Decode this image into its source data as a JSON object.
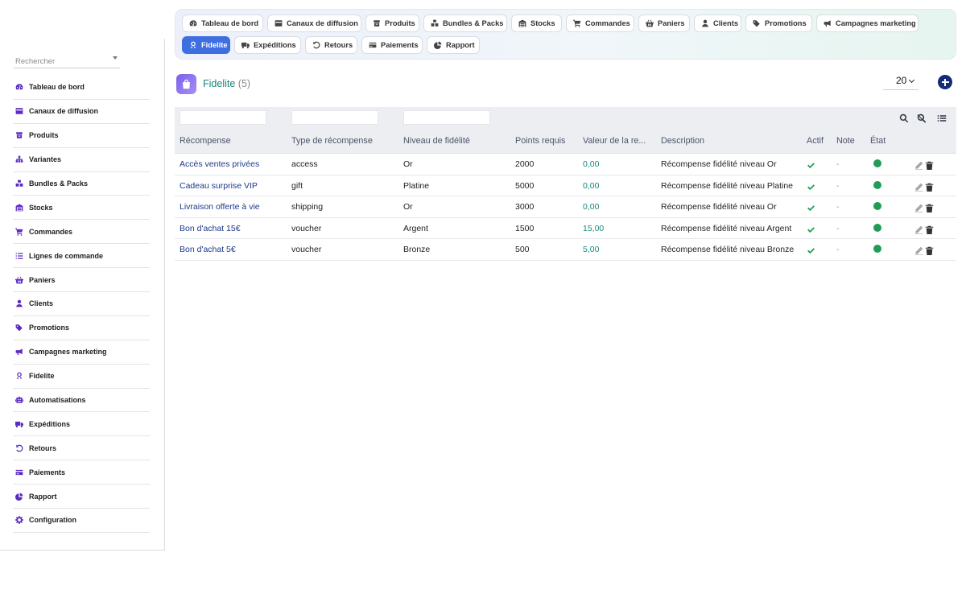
{
  "sidebar": {
    "search_placeholder": "Rechercher",
    "items": [
      {
        "label": "Tableau de bord",
        "icon": "gauge-icon"
      },
      {
        "label": "Canaux de diffusion",
        "icon": "channel-icon"
      },
      {
        "label": "Produits",
        "icon": "box-icon"
      },
      {
        "label": "Variantes",
        "icon": "sitemap-icon"
      },
      {
        "label": "Bundles & Packs",
        "icon": "boxes-icon"
      },
      {
        "label": "Stocks",
        "icon": "warehouse-icon"
      },
      {
        "label": "Commandes",
        "icon": "cart-icon"
      },
      {
        "label": "Lignes de commande",
        "icon": "list-icon"
      },
      {
        "label": "Paniers",
        "icon": "basket-icon"
      },
      {
        "label": "Clients",
        "icon": "user-icon"
      },
      {
        "label": "Promotions",
        "icon": "tags-icon"
      },
      {
        "label": "Campagnes marketing",
        "icon": "megaphone-icon"
      },
      {
        "label": "Fidelite",
        "icon": "award-icon"
      },
      {
        "label": "Automatisations",
        "icon": "robot-icon"
      },
      {
        "label": "Expéditions",
        "icon": "truck-icon"
      },
      {
        "label": "Retours",
        "icon": "undo-icon"
      },
      {
        "label": "Paiements",
        "icon": "credit-card-icon"
      },
      {
        "label": "Rapport",
        "icon": "pie-chart-icon"
      },
      {
        "label": "Configuration",
        "icon": "gear-icon"
      }
    ]
  },
  "tabs": [
    {
      "label": "Tableau de bord",
      "icon": "gauge-icon",
      "active": false
    },
    {
      "label": "Canaux de diffusion",
      "icon": "channel-icon",
      "active": false
    },
    {
      "label": "Produits",
      "icon": "box-icon",
      "active": false
    },
    {
      "label": "Bundles & Packs",
      "icon": "boxes-icon",
      "active": false
    },
    {
      "label": "Stocks",
      "icon": "warehouse-icon",
      "active": false
    },
    {
      "label": "Commandes",
      "icon": "cart-icon",
      "active": false
    },
    {
      "label": "Paniers",
      "icon": "basket-icon",
      "active": false
    },
    {
      "label": "Clients",
      "icon": "user-icon",
      "active": false
    },
    {
      "label": "Promotions",
      "icon": "tags-icon",
      "active": false
    },
    {
      "label": "Campagnes marketing",
      "icon": "megaphone-icon",
      "active": false
    },
    {
      "label": "Fidelite",
      "icon": "award-icon",
      "active": true
    },
    {
      "label": "Expéditions",
      "icon": "truck-icon",
      "active": false
    },
    {
      "label": "Retours",
      "icon": "undo-icon",
      "active": false
    },
    {
      "label": "Paiements",
      "icon": "credit-card-icon",
      "active": false
    },
    {
      "label": "Rapport",
      "icon": "pie-chart-icon",
      "active": false
    }
  ],
  "header": {
    "title": "Fidelite",
    "count": "(5)",
    "page_size": "20"
  },
  "table": {
    "columns": [
      "Récompense",
      "Type de récompense",
      "Niveau de fidélité",
      "Points requis",
      "Valeur de la re...",
      "Description",
      "Actif",
      "Note",
      "État"
    ],
    "rows": [
      {
        "recompense": "Accès ventes privées",
        "type": "access",
        "niveau": "Or",
        "points": "2000",
        "valeur": "0,00",
        "description": "Récompense fidélité niveau Or",
        "note": "-"
      },
      {
        "recompense": "Cadeau surprise VIP",
        "type": "gift",
        "niveau": "Platine",
        "points": "5000",
        "valeur": "0,00",
        "description": "Récompense fidélité niveau Platine",
        "note": "-"
      },
      {
        "recompense": "Livraison offerte à vie",
        "type": "shipping",
        "niveau": "Or",
        "points": "3000",
        "valeur": "0,00",
        "description": "Récompense fidélité niveau Or",
        "note": "-"
      },
      {
        "recompense": "Bon d'achat 15€",
        "type": "voucher",
        "niveau": "Argent",
        "points": "1500",
        "valeur": "15,00",
        "description": "Récompense fidélité niveau Argent",
        "note": "-"
      },
      {
        "recompense": "Bon d'achat 5€",
        "type": "voucher",
        "niveau": "Bronze",
        "points": "500",
        "valeur": "5,00",
        "description": "Récompense fidélité niveau Bronze",
        "note": "-"
      }
    ]
  },
  "colors": {
    "accent": "#3d6fe0",
    "icon_purple": "#5b2bc4",
    "title_teal": "#16877a",
    "active_green": "#1f9d55",
    "add_button": "#172a7a"
  }
}
